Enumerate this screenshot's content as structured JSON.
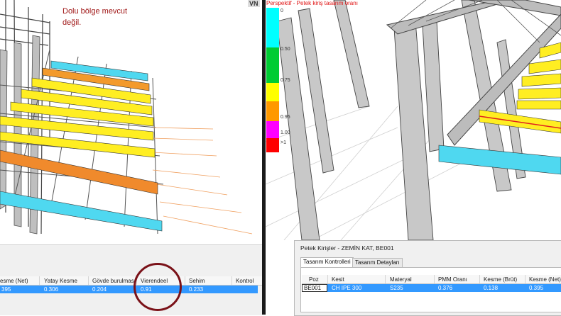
{
  "annotation": {
    "line1": "Dolu bölge mevcut",
    "line2": "değil."
  },
  "left_grid": {
    "headers": [
      "esme (Net)",
      "Yatay Kesme",
      "Gövde burulması",
      "Vierendeel",
      "Sehim",
      "Kontrol"
    ],
    "row": [
      "395",
      "0.306",
      "0.204",
      "0.91",
      "0.233",
      ""
    ]
  },
  "viewport": {
    "toolbar_label": "VN",
    "legend_title": "Perspektif - Petek kiriş tasarım oranı",
    "legend": [
      {
        "label": "0",
        "color": "#00ffff"
      },
      {
        "label": "0.50",
        "color": "#00cc33"
      },
      {
        "label": "0.75",
        "color": "#ffff00"
      },
      {
        "label": "0.95",
        "color": "#ff9900"
      },
      {
        "label": "1.00",
        "color": "#ff00ff"
      },
      {
        "label": ">1",
        "color": "#ff0000"
      }
    ]
  },
  "right_dialog": {
    "title": "Petek Kirişler - ZEMİN KAT, BE001",
    "tabs": [
      "Tasarım Kontrolleri",
      "Tasarım Detayları"
    ],
    "headers": [
      "Poz",
      "Kesit",
      "Materyal",
      "PMM Oranı",
      "Kesme (Brüt)",
      "Kesme (Net)"
    ],
    "row": [
      "BE001",
      "CH IPE 300",
      "S235",
      "0.376",
      "0.138",
      "0.395"
    ]
  }
}
